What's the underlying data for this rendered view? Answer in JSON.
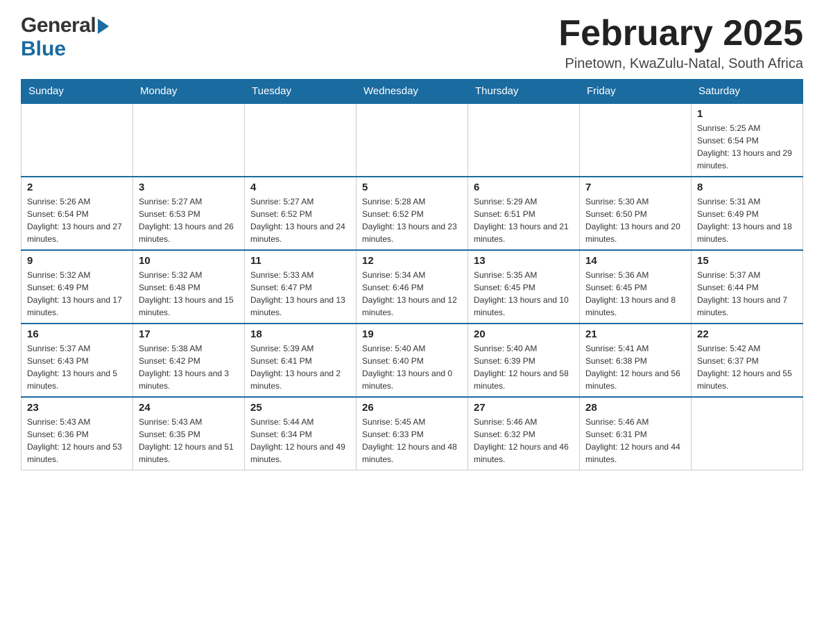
{
  "header": {
    "logo": {
      "general": "General",
      "blue": "Blue"
    },
    "title": "February 2025",
    "location": "Pinetown, KwaZulu-Natal, South Africa"
  },
  "calendar": {
    "days_of_week": [
      "Sunday",
      "Monday",
      "Tuesday",
      "Wednesday",
      "Thursday",
      "Friday",
      "Saturday"
    ],
    "weeks": [
      [
        {
          "day": "",
          "info": ""
        },
        {
          "day": "",
          "info": ""
        },
        {
          "day": "",
          "info": ""
        },
        {
          "day": "",
          "info": ""
        },
        {
          "day": "",
          "info": ""
        },
        {
          "day": "",
          "info": ""
        },
        {
          "day": "1",
          "info": "Sunrise: 5:25 AM\nSunset: 6:54 PM\nDaylight: 13 hours and 29 minutes."
        }
      ],
      [
        {
          "day": "2",
          "info": "Sunrise: 5:26 AM\nSunset: 6:54 PM\nDaylight: 13 hours and 27 minutes."
        },
        {
          "day": "3",
          "info": "Sunrise: 5:27 AM\nSunset: 6:53 PM\nDaylight: 13 hours and 26 minutes."
        },
        {
          "day": "4",
          "info": "Sunrise: 5:27 AM\nSunset: 6:52 PM\nDaylight: 13 hours and 24 minutes."
        },
        {
          "day": "5",
          "info": "Sunrise: 5:28 AM\nSunset: 6:52 PM\nDaylight: 13 hours and 23 minutes."
        },
        {
          "day": "6",
          "info": "Sunrise: 5:29 AM\nSunset: 6:51 PM\nDaylight: 13 hours and 21 minutes."
        },
        {
          "day": "7",
          "info": "Sunrise: 5:30 AM\nSunset: 6:50 PM\nDaylight: 13 hours and 20 minutes."
        },
        {
          "day": "8",
          "info": "Sunrise: 5:31 AM\nSunset: 6:49 PM\nDaylight: 13 hours and 18 minutes."
        }
      ],
      [
        {
          "day": "9",
          "info": "Sunrise: 5:32 AM\nSunset: 6:49 PM\nDaylight: 13 hours and 17 minutes."
        },
        {
          "day": "10",
          "info": "Sunrise: 5:32 AM\nSunset: 6:48 PM\nDaylight: 13 hours and 15 minutes."
        },
        {
          "day": "11",
          "info": "Sunrise: 5:33 AM\nSunset: 6:47 PM\nDaylight: 13 hours and 13 minutes."
        },
        {
          "day": "12",
          "info": "Sunrise: 5:34 AM\nSunset: 6:46 PM\nDaylight: 13 hours and 12 minutes."
        },
        {
          "day": "13",
          "info": "Sunrise: 5:35 AM\nSunset: 6:45 PM\nDaylight: 13 hours and 10 minutes."
        },
        {
          "day": "14",
          "info": "Sunrise: 5:36 AM\nSunset: 6:45 PM\nDaylight: 13 hours and 8 minutes."
        },
        {
          "day": "15",
          "info": "Sunrise: 5:37 AM\nSunset: 6:44 PM\nDaylight: 13 hours and 7 minutes."
        }
      ],
      [
        {
          "day": "16",
          "info": "Sunrise: 5:37 AM\nSunset: 6:43 PM\nDaylight: 13 hours and 5 minutes."
        },
        {
          "day": "17",
          "info": "Sunrise: 5:38 AM\nSunset: 6:42 PM\nDaylight: 13 hours and 3 minutes."
        },
        {
          "day": "18",
          "info": "Sunrise: 5:39 AM\nSunset: 6:41 PM\nDaylight: 13 hours and 2 minutes."
        },
        {
          "day": "19",
          "info": "Sunrise: 5:40 AM\nSunset: 6:40 PM\nDaylight: 13 hours and 0 minutes."
        },
        {
          "day": "20",
          "info": "Sunrise: 5:40 AM\nSunset: 6:39 PM\nDaylight: 12 hours and 58 minutes."
        },
        {
          "day": "21",
          "info": "Sunrise: 5:41 AM\nSunset: 6:38 PM\nDaylight: 12 hours and 56 minutes."
        },
        {
          "day": "22",
          "info": "Sunrise: 5:42 AM\nSunset: 6:37 PM\nDaylight: 12 hours and 55 minutes."
        }
      ],
      [
        {
          "day": "23",
          "info": "Sunrise: 5:43 AM\nSunset: 6:36 PM\nDaylight: 12 hours and 53 minutes."
        },
        {
          "day": "24",
          "info": "Sunrise: 5:43 AM\nSunset: 6:35 PM\nDaylight: 12 hours and 51 minutes."
        },
        {
          "day": "25",
          "info": "Sunrise: 5:44 AM\nSunset: 6:34 PM\nDaylight: 12 hours and 49 minutes."
        },
        {
          "day": "26",
          "info": "Sunrise: 5:45 AM\nSunset: 6:33 PM\nDaylight: 12 hours and 48 minutes."
        },
        {
          "day": "27",
          "info": "Sunrise: 5:46 AM\nSunset: 6:32 PM\nDaylight: 12 hours and 46 minutes."
        },
        {
          "day": "28",
          "info": "Sunrise: 5:46 AM\nSunset: 6:31 PM\nDaylight: 12 hours and 44 minutes."
        },
        {
          "day": "",
          "info": ""
        }
      ]
    ]
  }
}
